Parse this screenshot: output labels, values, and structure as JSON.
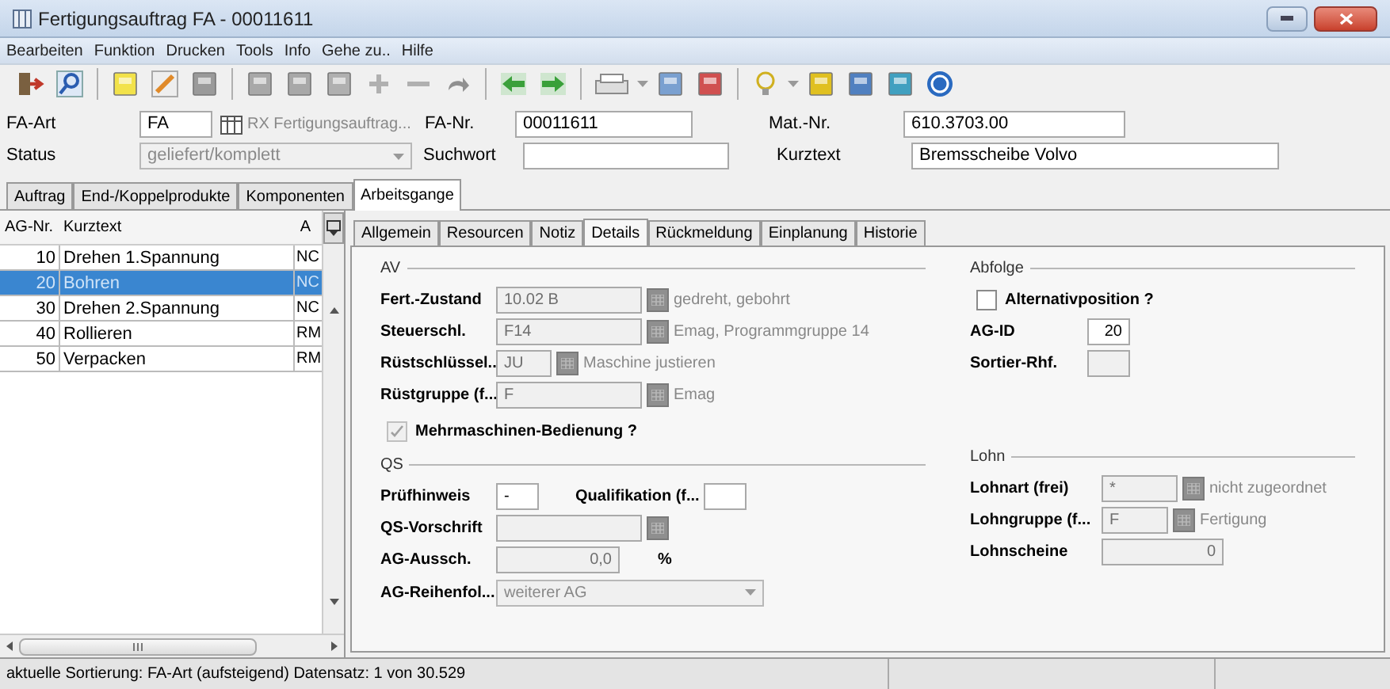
{
  "window": {
    "title": "Fertigungsauftrag FA - 00011611"
  },
  "menu": [
    "Bearbeiten",
    "Funktion",
    "Drucken",
    "Tools",
    "Info",
    "Gehe zu..",
    "Hilfe"
  ],
  "header": {
    "fa_art": {
      "label": "FA-Art",
      "value": "FA",
      "lookup_text": "RX Fertigungsauftrag..."
    },
    "fa_nr": {
      "label": "FA-Nr.",
      "value": "00011611"
    },
    "mat_nr": {
      "label": "Mat.-Nr.",
      "value": "610.3703.00"
    },
    "status": {
      "label": "Status",
      "value": "geliefert/komplett",
      "disabled": true
    },
    "suchwort": {
      "label": "Suchwort"
    },
    "kurztext": {
      "label": "Kurztext",
      "value": "Bremsscheibe Volvo"
    }
  },
  "main_tabs": [
    {
      "label": "Auftrag",
      "selected": false
    },
    {
      "label": "End-/Koppelprodukte",
      "selected": false
    },
    {
      "label": "Komponenten",
      "selected": false
    },
    {
      "label": "Arbeitsgange",
      "selected": true
    }
  ],
  "table": {
    "columns": [
      "AG-Nr.",
      "Kurztext",
      "A"
    ],
    "rows": [
      {
        "cells": [
          "10",
          "Drehen 1.Spannung",
          "NC"
        ],
        "selected": false
      },
      {
        "cells": [
          "20",
          "Bohren",
          "NC"
        ],
        "selected": true
      },
      {
        "cells": [
          "30",
          "Drehen 2.Spannung",
          "NC"
        ],
        "selected": false
      },
      {
        "cells": [
          "40",
          "Rollieren",
          "RM"
        ],
        "selected": false
      },
      {
        "cells": [
          "50",
          "Verpacken",
          "RM"
        ],
        "selected": false
      }
    ]
  },
  "detail_tabs": [
    {
      "label": "Allgemein",
      "selected": false
    },
    {
      "label": "Resourcen",
      "selected": false
    },
    {
      "label": "Notiz",
      "selected": false
    },
    {
      "label": "Details",
      "selected": true
    },
    {
      "label": "Rückmeldung",
      "selected": false
    },
    {
      "label": "Einplanung",
      "selected": false
    },
    {
      "label": "Historie",
      "selected": false
    }
  ],
  "av": {
    "title": "AV",
    "rows": [
      {
        "label": "Fert.-Zustand",
        "value": "10.02 B",
        "description": "gedreht, gebohrt",
        "short": false
      },
      {
        "label": "Steuerschl.",
        "value": "F14",
        "description": "Emag, Programmgruppe 14",
        "short": false
      },
      {
        "label": "Rüstschlüssel..",
        "value": "JU",
        "description": "Maschine justieren",
        "short": true
      },
      {
        "label": "Rüstgruppe (f...",
        "value": "F",
        "description": "Emag",
        "short": false
      }
    ],
    "checkbox": {
      "label": "Mehrmaschinen-Bedienung ?",
      "checked": true,
      "disabled": true
    }
  },
  "qs": {
    "title": "QS",
    "pruefhinweis": {
      "label": "Prüfhinweis",
      "value": "-"
    },
    "qualifikation": {
      "label": "Qualifikation (f..."
    },
    "vorschrift": {
      "label": "QS-Vorschrift"
    },
    "ausschuss": {
      "label": "AG-Aussch.",
      "value": "0,0",
      "unit": "%"
    },
    "reihenfolge": {
      "label": "AG-Reihenfol...",
      "value": "weiterer AG"
    }
  },
  "abfolge": {
    "title": "Abfolge",
    "checkbox": {
      "label": "Alternativposition ?",
      "checked": false
    },
    "ag_id": {
      "label": "AG-ID",
      "value": "20"
    },
    "sortier": {
      "label": "Sortier-Rhf."
    }
  },
  "lohn": {
    "title": "Lohn",
    "rows": [
      {
        "label": "Lohnart (frei)",
        "value": "*",
        "description": "nicht zugeordnet"
      },
      {
        "label": "Lohngruppe (f...",
        "value": "F",
        "description": "Fertigung"
      }
    ],
    "lohnscheine": {
      "label": "Lohnscheine",
      "value": "0"
    }
  },
  "status_bar": "aktuelle Sortierung: FA-Art (aufsteigend) Datensatz: 1 von 30.529"
}
